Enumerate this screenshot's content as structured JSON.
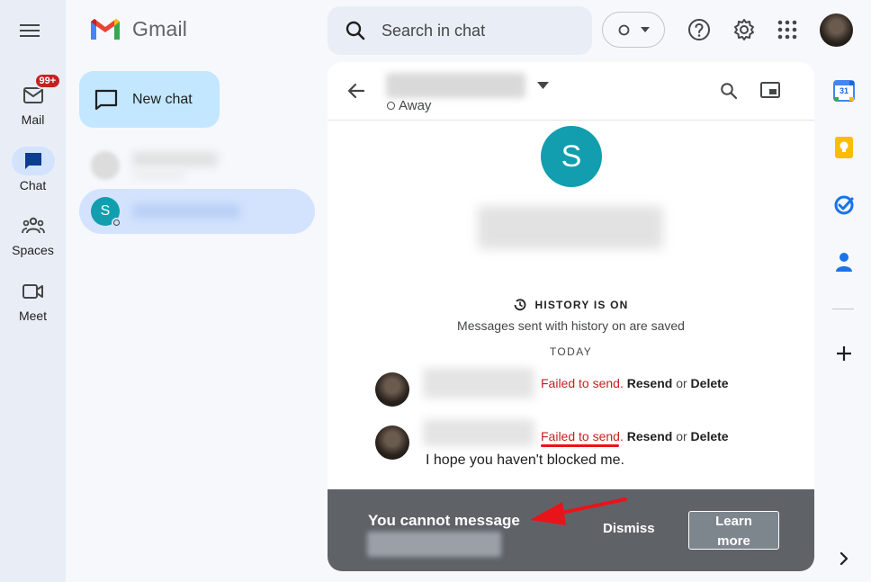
{
  "rail": {
    "items": [
      {
        "label": "Mail",
        "badge": "99+"
      },
      {
        "label": "Chat"
      },
      {
        "label": "Spaces"
      },
      {
        "label": "Meet"
      }
    ]
  },
  "header": {
    "logo_text": "Gmail",
    "search_placeholder": "Search in chat"
  },
  "sidebar": {
    "new_chat_label": "New chat",
    "active_avatar_letter": "S"
  },
  "chat": {
    "status": "Away",
    "avatar_letter": "S",
    "history_label": "HISTORY IS ON",
    "history_sub": "Messages sent with history on are saved",
    "today_label": "TODAY",
    "failed_text": "Failed to send.",
    "resend_label": "Resend",
    "or_text": "or",
    "delete_label": "Delete",
    "message_text": "I hope you haven't blocked me."
  },
  "snackbar": {
    "title": "You cannot message",
    "dismiss_label": "Dismiss",
    "learn_more_label": "Learn more"
  },
  "side_panel": {
    "calendar_day": "31"
  },
  "colors": {
    "accent_red": "#c5221f",
    "avatar_teal": "#129eaf",
    "new_chat_bg": "#c2e7ff",
    "active_bg": "#d3e3fd"
  }
}
